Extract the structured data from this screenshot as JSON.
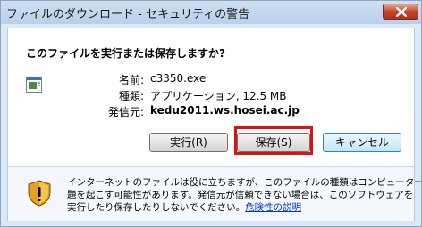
{
  "dialog": {
    "title": "ファイルのダウンロード - セキュリティの警告",
    "question": "このファイルを実行または保存しますか?"
  },
  "file": {
    "name_label": "名前:",
    "name_value": "c3350.exe",
    "type_label": "種類:",
    "type_value": "アプリケーション, 12.5 MB",
    "source_label": "発信元:",
    "source_value": "kedu2011.ws.hosei.ac.jp"
  },
  "buttons": {
    "run": "実行(R)",
    "save": "保存(S)",
    "cancel": "キャンセル"
  },
  "warning": {
    "line1": "インターネットのファイルは役に立ちますが、このファイルの種類はコンピューターに問",
    "line2": "題を起こす可能性があります。発信元が信頼できない場合は、このソフトウェアを",
    "line3_text": "実行したり保存したりしないでください。",
    "line3_link": "危険性の説明"
  },
  "icons": {
    "close": "close-icon",
    "file": "application-file-icon",
    "shield": "security-shield-icon"
  },
  "colors": {
    "highlight": "#e01010",
    "close_button": "#c6432b",
    "link": "#0033cc"
  }
}
